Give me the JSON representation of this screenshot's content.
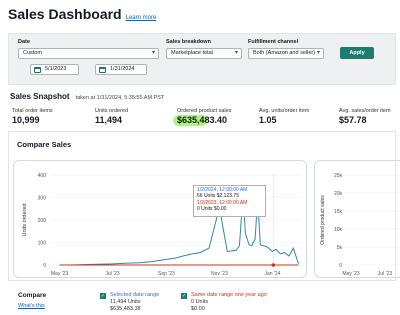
{
  "header": {
    "title": "Sales Dashboard",
    "learn_more": "Learn more"
  },
  "filters": {
    "date_label": "Date",
    "date_value": "Custom",
    "start_date": "5/1/2023",
    "end_date": "1/31/2024",
    "breakdown_label": "Sales breakdown",
    "breakdown_value": "Marketplace total",
    "fulfillment_label": "Fulfillment channel",
    "fulfillment_value": "Both (Amazon and seller)",
    "apply": "Apply"
  },
  "snapshot": {
    "title": "Sales Snapshot",
    "timestamp": "taken at 1/31/2024, 5:35:55 AM PST",
    "metrics": [
      {
        "label": "Total order items",
        "value": "10,999"
      },
      {
        "label": "Units ordered",
        "value": "11,494"
      },
      {
        "label": "Ordered product sales",
        "value": "$635,483.40"
      },
      {
        "label": "Avg. units/order item",
        "value": "1.05"
      },
      {
        "label": "Avg. sales/order item",
        "value": "$57.78"
      }
    ]
  },
  "compare_sales": {
    "title": "Compare Sales",
    "tooltip": {
      "line1": "1/2/2024, 12:00:00 AM",
      "line2": "66 Units $2,123.75",
      "line3": "1/2/2023, 12:00:00 AM",
      "line4": "0 Units $0.00"
    },
    "compare_label": "Compare",
    "whats_this": "What's this",
    "selected": {
      "label": "Selected date range",
      "units": "11,494 Units",
      "sales": "$635,483.38"
    },
    "previous": {
      "label": "Same date range one year ago",
      "units": "0 Units",
      "sales": "$0.00"
    }
  },
  "chart_data": [
    {
      "type": "line",
      "ylabel": "Units ordered",
      "ylim": [
        0,
        400
      ],
      "yticks": [
        "0",
        "100",
        "200",
        "300",
        "400"
      ],
      "xticks": [
        "May '23",
        "Jul '23",
        "Sep '23",
        "Nov '23",
        "Jan '24"
      ],
      "series": [
        {
          "name": "Selected date range",
          "color": "#2e8b9a",
          "x": [
            "2023-05-01",
            "2023-05-15",
            "2023-06-01",
            "2023-06-15",
            "2023-07-01",
            "2023-07-15",
            "2023-08-01",
            "2023-08-15",
            "2023-09-01",
            "2023-09-10",
            "2023-09-20",
            "2023-10-01",
            "2023-10-10",
            "2023-10-20",
            "2023-11-01",
            "2023-11-10",
            "2023-11-20",
            "2023-11-24",
            "2023-11-28",
            "2023-12-01",
            "2023-12-05",
            "2023-12-08",
            "2023-12-12",
            "2023-12-15",
            "2023-12-18",
            "2023-12-22",
            "2023-12-26",
            "2024-01-01",
            "2024-01-05",
            "2024-01-10",
            "2024-01-15",
            "2024-01-20",
            "2024-01-25",
            "2024-01-31"
          ],
          "values": [
            0,
            0,
            2,
            3,
            5,
            8,
            10,
            15,
            25,
            30,
            40,
            50,
            55,
            75,
            255,
            60,
            65,
            85,
            305,
            140,
            90,
            85,
            115,
            300,
            90,
            85,
            80,
            60,
            70,
            50,
            55,
            40,
            75,
            5
          ]
        },
        {
          "name": "Same date range one year ago",
          "color": "#d13212",
          "x": [
            "2023-05-01",
            "2024-01-31"
          ],
          "values": [
            0,
            0
          ]
        }
      ]
    },
    {
      "type": "line",
      "ylabel": "Ordered product sales",
      "yticks": [
        "0",
        "5k",
        "10k",
        "15k",
        "20k",
        "25k"
      ],
      "xticks": [
        "May '23",
        "Jul '23"
      ],
      "series": []
    }
  ]
}
